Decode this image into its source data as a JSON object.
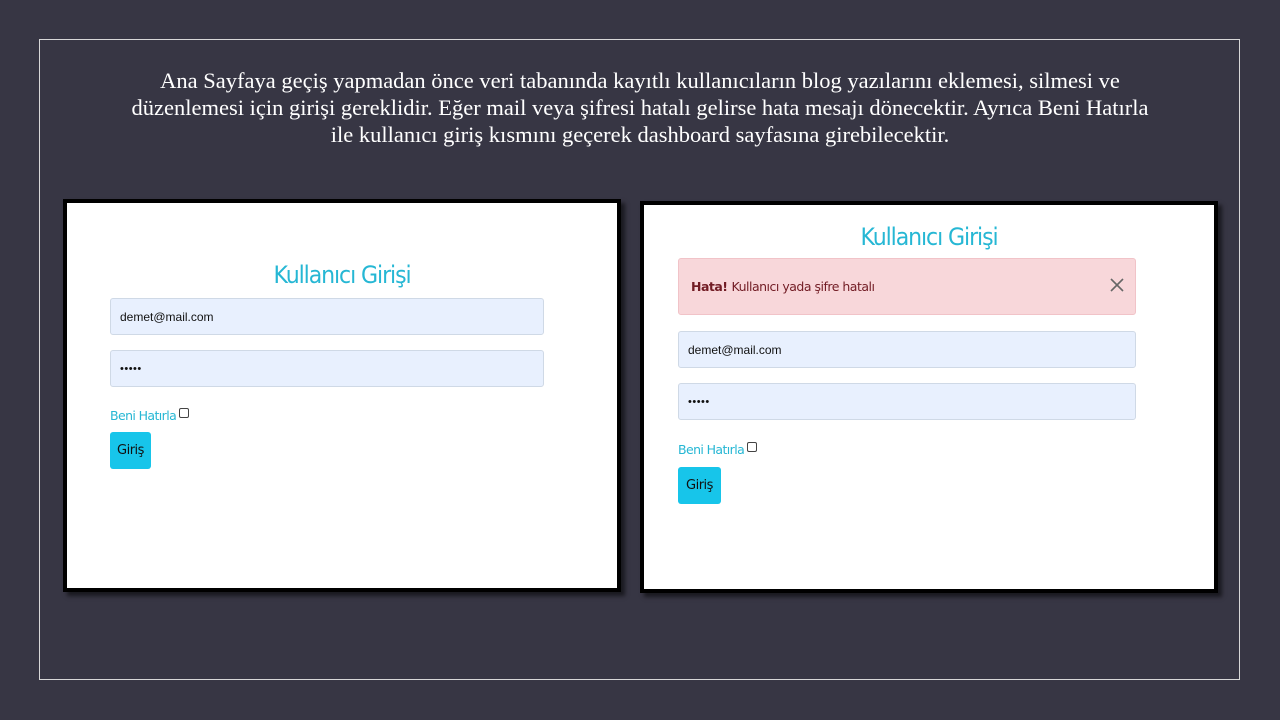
{
  "caption": {
    "line1": "Ana Sayfaya geçiş yapmadan önce veri tabanında kayıtlı kullanıcıların blog yazılarını eklemesi, silmesi ve",
    "line2": "düzenlemesi için girişi gereklidir. Eğer mail veya şifresi hatalı gelirse hata mesajı dönecektir. Ayrıca Beni Hatırla",
    "line3": "ile kullanıcı giriş kısmını geçerek dashboard sayfasına girebilecektir."
  },
  "left_login": {
    "title": "Kullanıcı Girişi",
    "email_value": "demet@mail.com",
    "password_mask": "•••••",
    "remember_label": "Beni Hatırla",
    "remember_checked": false,
    "submit_label": "Giriş"
  },
  "right_login": {
    "title": "Kullanıcı Girişi",
    "alert_strong": "Hata!",
    "alert_text": "Kullanıcı yada şifre hatalı",
    "alert_close_icon": "close-icon",
    "email_value": "demet@mail.com",
    "password_mask": "•••••",
    "remember_label": "Beni Hatırla",
    "remember_checked": false,
    "submit_label": "Giriş"
  },
  "colors": {
    "slide_background": "#373644",
    "title_cyan": "#26b7d4",
    "button_cyan": "#17c5ea",
    "input_fill": "#e8f0fe",
    "alert_fill": "#f8d7da",
    "alert_text": "#721c24"
  }
}
